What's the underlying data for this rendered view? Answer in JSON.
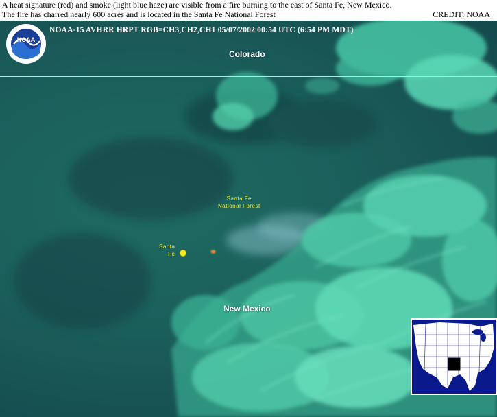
{
  "caption": {
    "line1": "A heat signature (red) and smoke (light blue haze) are visible from a fire burning to the east of Santa Fe, New Mexico.",
    "line2": "The fire has charred nearly 600 acres and is located in the Santa Fe National Forest"
  },
  "credit": "CREDIT: NOAA",
  "image_header": "NOAA-15 AVHRR HRPT  RGB=CH3,CH2,CH1  05/07/2002  00:54 UTC  (6:54 PM MDT)",
  "logo": {
    "text": "NOAA",
    "icon": "noaa-logo"
  },
  "labels": {
    "colorado": "Colorado",
    "new_mexico": "New Mexico",
    "national_forest_line1": "Santa Fe",
    "national_forest_line2": "National Forest",
    "city_line1": "Santa",
    "city_line2": "Fe"
  },
  "colors": {
    "label_yellow": "#f4e72a",
    "border_line": "#f2e05a",
    "fire": "#ff7a2a",
    "inset_background": "#0a1a8c",
    "inset_land": "#ffffff"
  }
}
